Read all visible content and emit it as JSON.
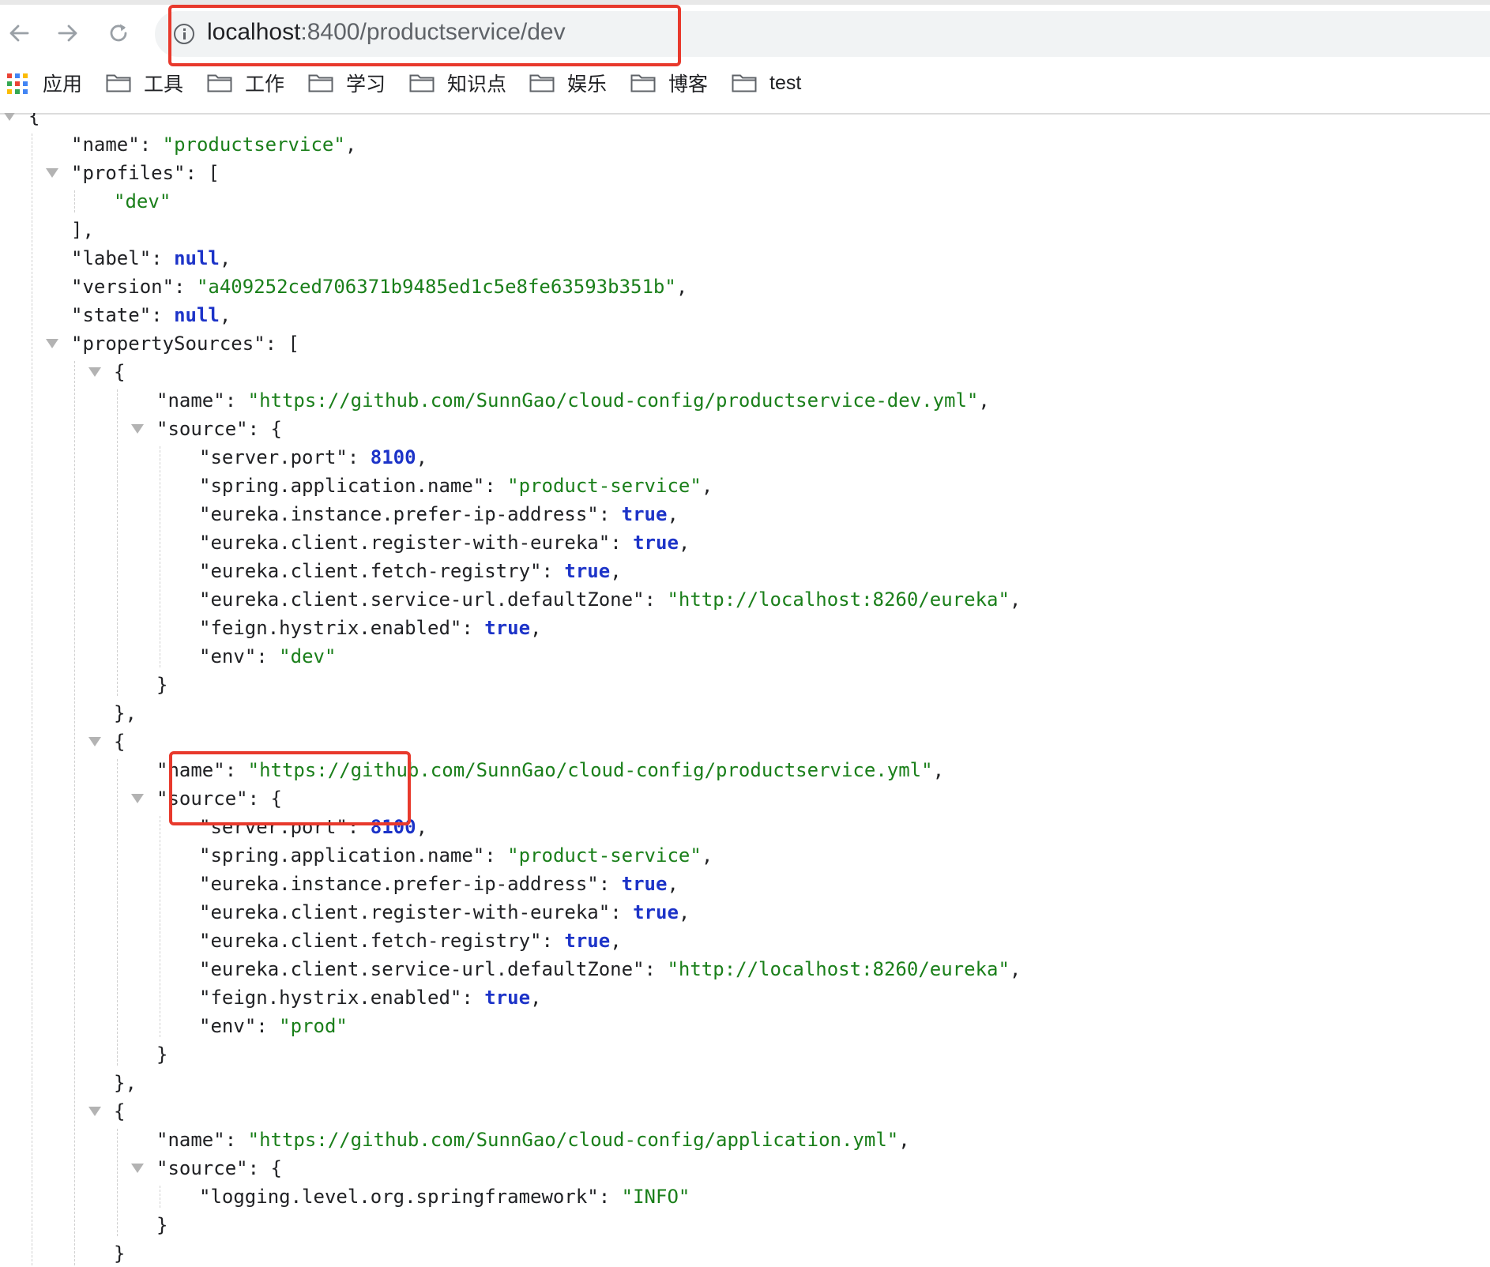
{
  "browser": {
    "url_host": "localhost",
    "url_path": ":8400/productservice/dev"
  },
  "bookmarks": [
    {
      "label": "应用",
      "icon": "apps-grid-icon"
    },
    {
      "label": "工具",
      "icon": "folder-icon"
    },
    {
      "label": "工作",
      "icon": "folder-icon"
    },
    {
      "label": "学习",
      "icon": "folder-icon"
    },
    {
      "label": "知识点",
      "icon": "folder-icon"
    },
    {
      "label": "娱乐",
      "icon": "folder-icon"
    },
    {
      "label": "博客",
      "icon": "folder-icon"
    },
    {
      "label": "test",
      "icon": "folder-icon"
    }
  ],
  "json": {
    "name": "productservice",
    "profiles": [
      "dev"
    ],
    "label": "null",
    "version": "a409252ced706371b9485ed1c5e8fe63593b351b",
    "state": "null",
    "propertySources": [
      {
        "name": "https://github.com/SunnGao/cloud-config/productservice-dev.yml",
        "source": [
          {
            "key": "server.port",
            "value": "8100",
            "type": "number"
          },
          {
            "key": "spring.application.name",
            "value": "product-service",
            "type": "string"
          },
          {
            "key": "eureka.instance.prefer-ip-address",
            "value": "true",
            "type": "bool"
          },
          {
            "key": "eureka.client.register-with-eureka",
            "value": "true",
            "type": "bool"
          },
          {
            "key": "eureka.client.fetch-registry",
            "value": "true",
            "type": "bool"
          },
          {
            "key": "eureka.client.service-url.defaultZone",
            "value": "http://localhost:8260/eureka",
            "type": "string"
          },
          {
            "key": "feign.hystrix.enabled",
            "value": "true",
            "type": "bool"
          },
          {
            "key": "env",
            "value": "dev",
            "type": "string"
          }
        ]
      },
      {
        "name": "https://github.com/SunnGao/cloud-config/productservice.yml",
        "source": [
          {
            "key": "server.port",
            "value": "8100",
            "type": "number"
          },
          {
            "key": "spring.application.name",
            "value": "product-service",
            "type": "string"
          },
          {
            "key": "eureka.instance.prefer-ip-address",
            "value": "true",
            "type": "bool"
          },
          {
            "key": "eureka.client.register-with-eureka",
            "value": "true",
            "type": "bool"
          },
          {
            "key": "eureka.client.fetch-registry",
            "value": "true",
            "type": "bool"
          },
          {
            "key": "eureka.client.service-url.defaultZone",
            "value": "http://localhost:8260/eureka",
            "type": "string"
          },
          {
            "key": "feign.hystrix.enabled",
            "value": "true",
            "type": "bool"
          },
          {
            "key": "env",
            "value": "prod",
            "type": "string"
          }
        ]
      },
      {
        "name": "https://github.com/SunnGao/cloud-config/application.yml",
        "source": [
          {
            "key": "logging.level.org.springframework",
            "value": "INFO",
            "type": "string"
          }
        ]
      }
    ]
  },
  "colors": {
    "highlight": "#e8392c",
    "json_string": "#1a7f1a",
    "json_literal": "#1c33c8"
  }
}
